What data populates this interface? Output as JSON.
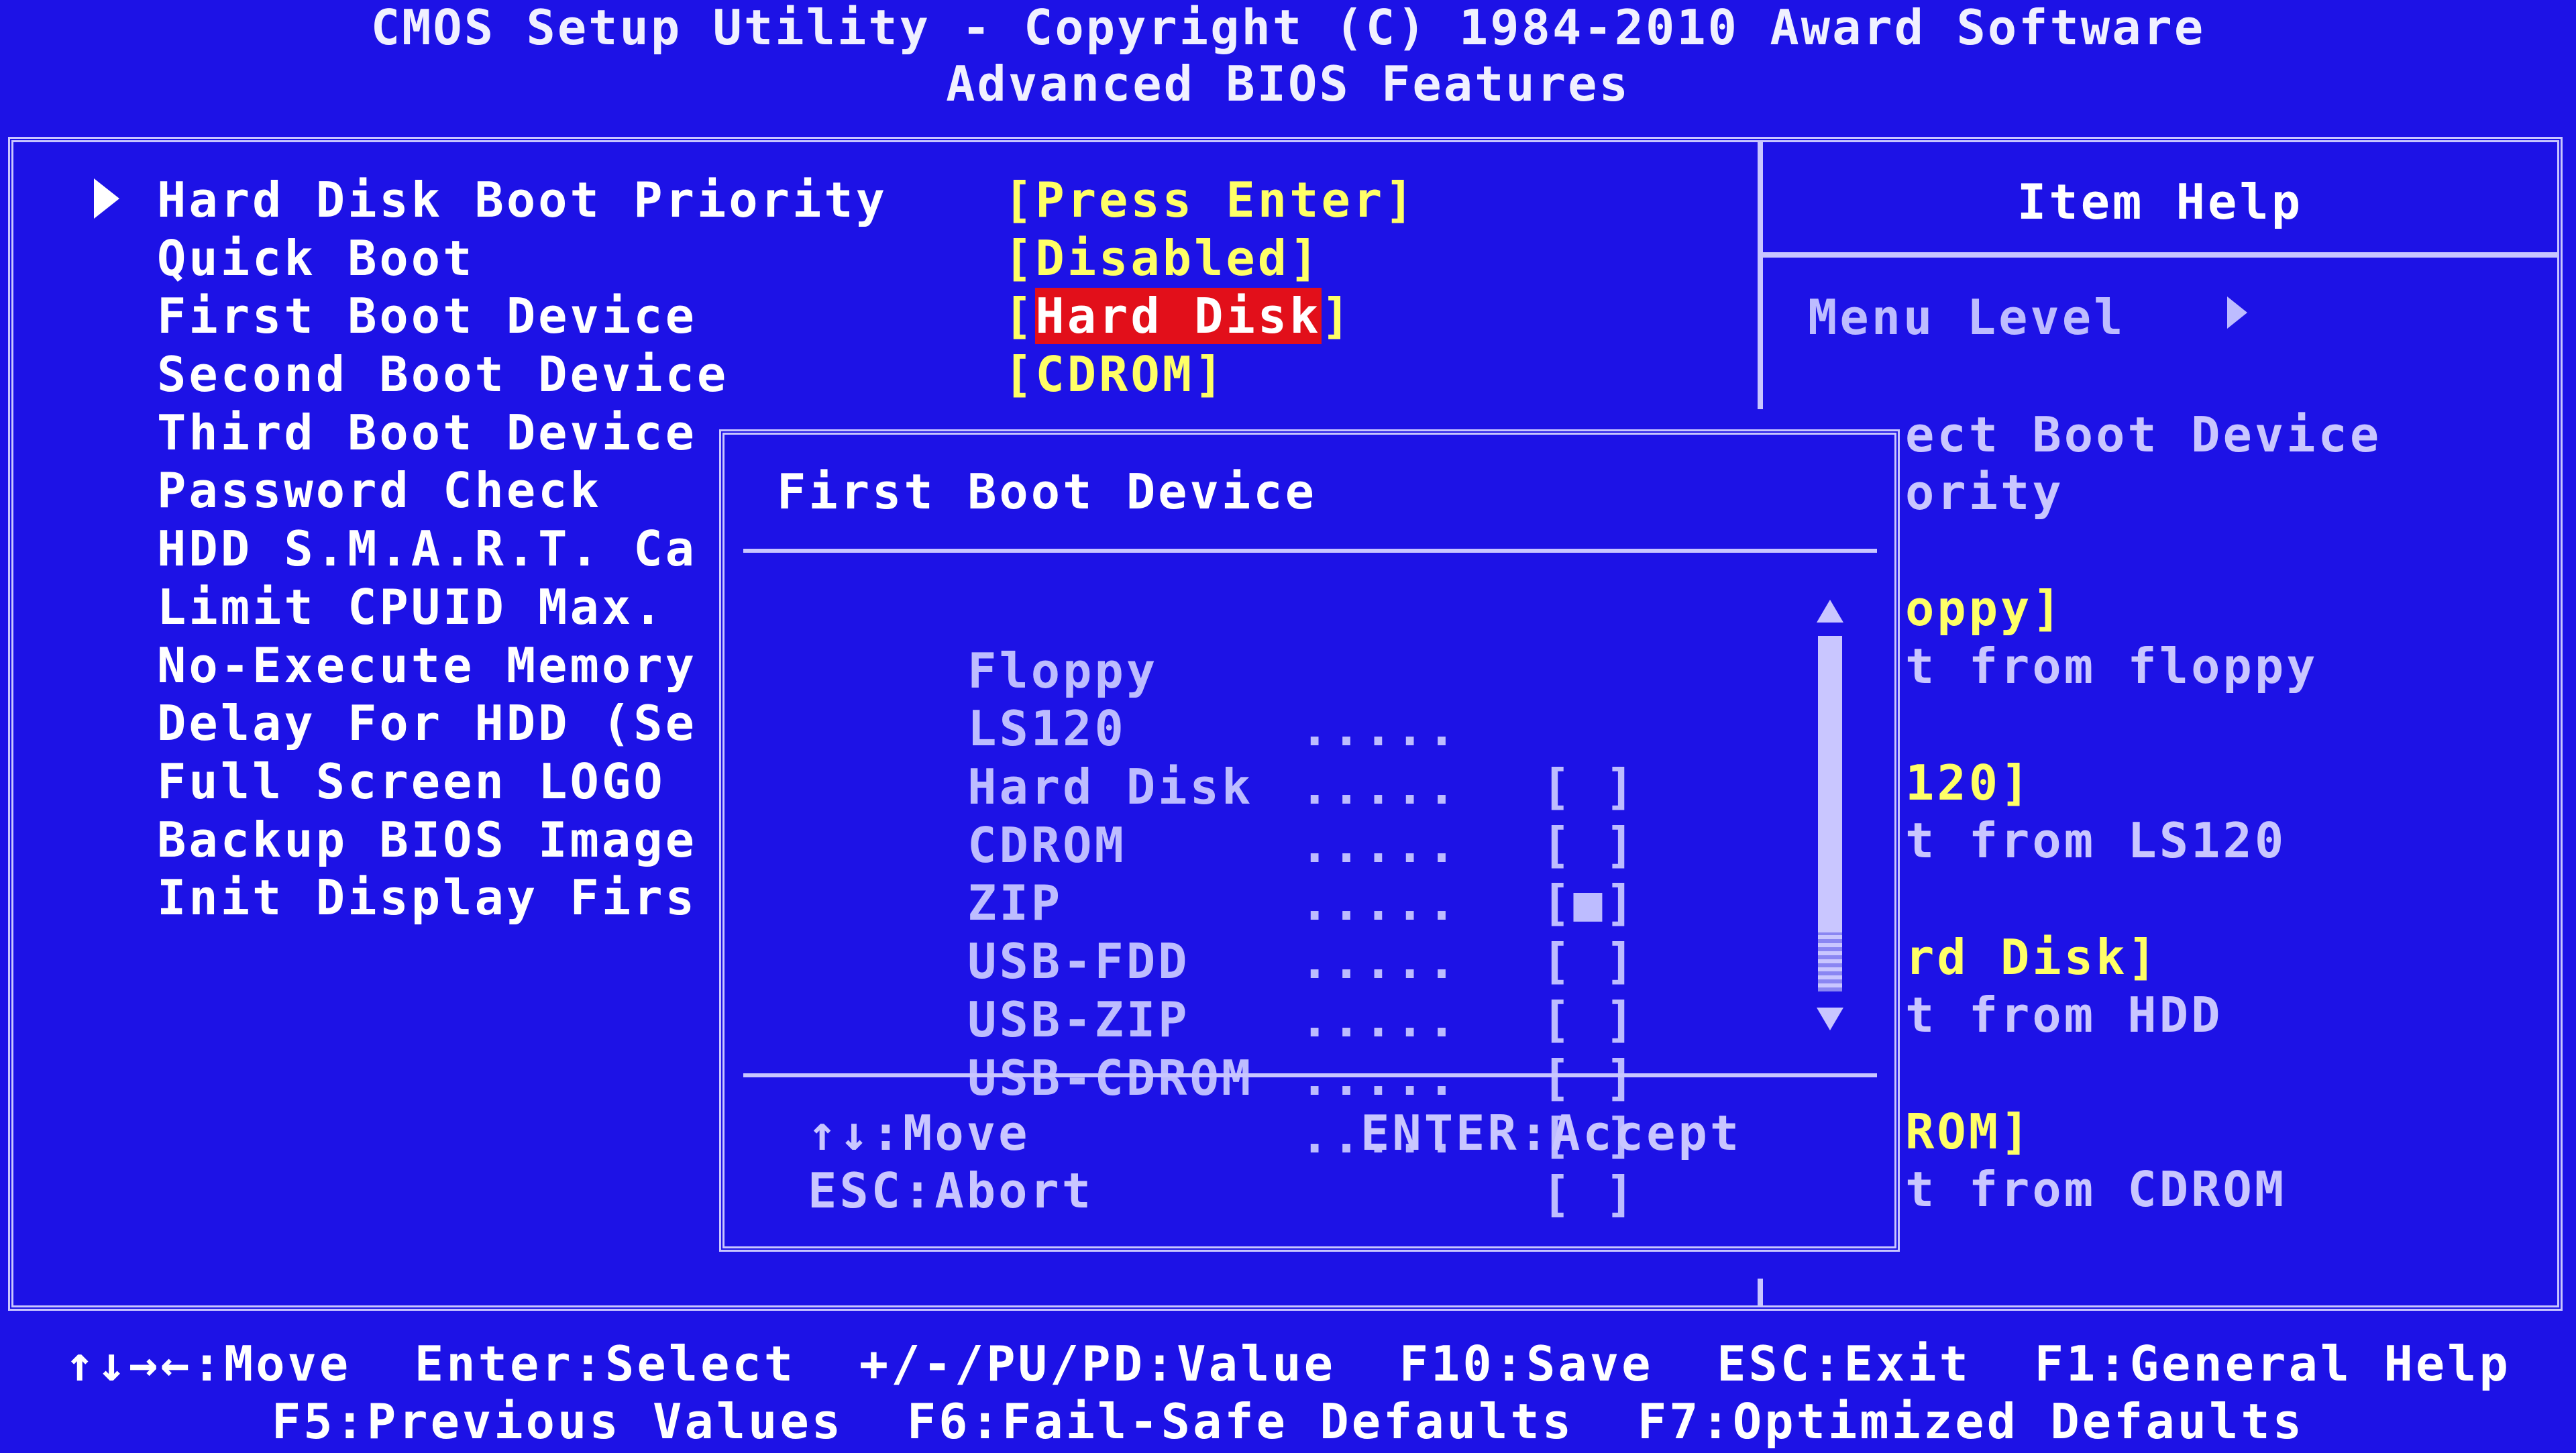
{
  "header": {
    "title": "CMOS Setup Utility - Copyright (C) 1984-2010 Award Software",
    "subtitle": "Advanced BIOS Features"
  },
  "settings": [
    {
      "label": "Hard Disk Boot Priority",
      "value": "[Press Enter]"
    },
    {
      "label": "Quick Boot",
      "value": "[Disabled]"
    },
    {
      "label": "First Boot Device",
      "value_prefix": "[",
      "value_highlight": "Hard Disk",
      "value_suffix": "]"
    },
    {
      "label": "Second Boot Device",
      "value": "[CDROM]"
    },
    {
      "label": "Third Boot Device"
    },
    {
      "label": "Password Check"
    },
    {
      "label": "HDD S.M.A.R.T. Ca"
    },
    {
      "label": "Limit CPUID Max."
    },
    {
      "label": "No-Execute Memory"
    },
    {
      "label": "Delay For HDD (Se"
    },
    {
      "label": "Full Screen LOGO"
    },
    {
      "label": "Backup BIOS Image"
    },
    {
      "label": "Init Display Firs"
    }
  ],
  "help": {
    "title": "Item Help",
    "menu_level": "Menu Level",
    "lines": [
      {
        "text": "ect Boot Device",
        "style": "w"
      },
      {
        "text": "ority",
        "style": "w"
      },
      {
        "text": "oppy]",
        "style": "y"
      },
      {
        "text": "t from floppy",
        "style": "w"
      },
      {
        "text": "120]",
        "style": "y"
      },
      {
        "text": "t from LS120",
        "style": "w"
      },
      {
        "text": "rd Disk]",
        "style": "y"
      },
      {
        "text": "t from HDD",
        "style": "w"
      },
      {
        "text": "ROM]",
        "style": "y"
      },
      {
        "text": "t from CDROM",
        "style": "w"
      }
    ]
  },
  "popup": {
    "title": "First Boot Device",
    "options": [
      {
        "label": "Floppy",
        "dots": ".....",
        "box": "[ ]"
      },
      {
        "label": "LS120",
        "dots": ".....",
        "box": "[ ]"
      },
      {
        "label": "Hard Disk",
        "dots": ".....",
        "box": "[■]"
      },
      {
        "label": "CDROM",
        "dots": ".....",
        "box": "[ ]"
      },
      {
        "label": "ZIP",
        "dots": ".....",
        "box": "[ ]"
      },
      {
        "label": "USB-FDD",
        "dots": ".....",
        "box": "[ ]"
      },
      {
        "label": "USB-ZIP",
        "dots": ".....",
        "box": "[ ]"
      },
      {
        "label": "USB-CDROM",
        "dots": ".....",
        "box": "[ ]"
      }
    ],
    "selected": "Hard Disk",
    "keys": {
      "move": "↑↓:Move",
      "accept": "ENTER:Accept",
      "abort": "ESC:Abort"
    }
  },
  "footer": {
    "line1": "↑↓→←:Move  Enter:Select  +/-/PU/PD:Value  F10:Save  ESC:Exit  F1:General Help",
    "line2": "F5:Previous Values  F6:Fail-Safe Defaults  F7:Optimized Defaults"
  },
  "colors": {
    "background": "#1d12e6",
    "value_text": "#ffff66",
    "highlight_bg": "#e20f1a",
    "border": "#c9c6ff",
    "dim_text": "#bdbcff"
  }
}
